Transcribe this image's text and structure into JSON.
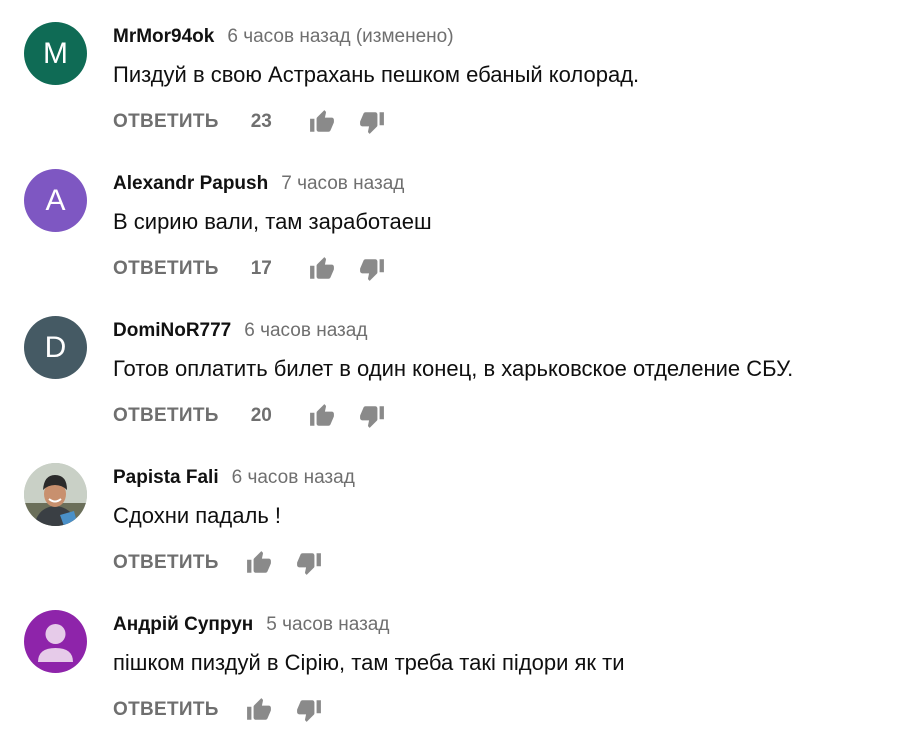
{
  "comments": [
    {
      "author": "MrMor94ok",
      "time": "6 часов назад (изменено)",
      "text": "Пиздуй в свою Астрахань пешком  ебаный колорад.",
      "avatar_letter": "M",
      "avatar_color": "#0f6b55",
      "reply_label": "ОТВЕТИТЬ",
      "likes": "23"
    },
    {
      "author": "Alexandr Papush",
      "time": "7 часов назад",
      "text": "В сирию вали,  там заработаеш",
      "avatar_letter": "A",
      "avatar_color": "#7e57c2",
      "reply_label": "ОТВЕТИТЬ",
      "likes": "17"
    },
    {
      "author": "DomiNoR777",
      "time": "6 часов назад",
      "text": "Готов оплатить билет в один конец, в харьковское отделение СБУ.",
      "avatar_letter": "D",
      "avatar_color": "#455a64",
      "reply_label": "ОТВЕТИТЬ",
      "likes": "20"
    },
    {
      "author": "Papista Fali",
      "time": "6 часов назад",
      "text": "Сдохни падаль !",
      "avatar_letter": "",
      "avatar_color": "#6b6f5a",
      "reply_label": "ОТВЕТИТЬ",
      "likes": ""
    },
    {
      "author": "Андрій Супрун",
      "time": "5 часов назад",
      "text": "пішком  пиздуй в Сірію, там треба такі підори як ти",
      "avatar_letter": "",
      "avatar_color": "#8e24aa",
      "reply_label": "ОТВЕТИТЬ",
      "likes": ""
    }
  ]
}
